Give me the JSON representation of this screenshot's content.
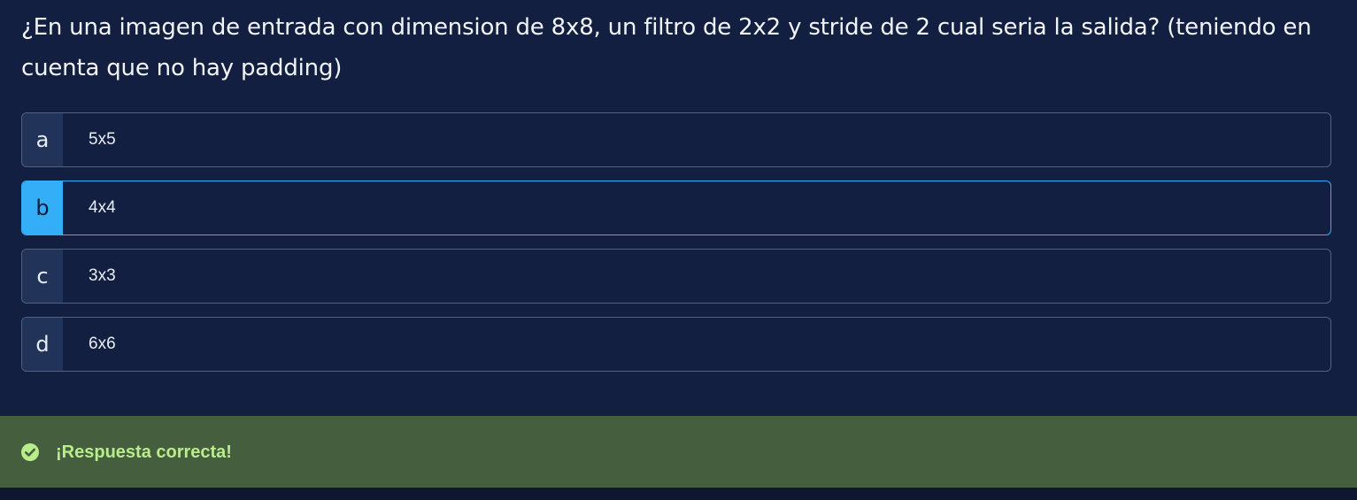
{
  "question": {
    "text": "¿En una imagen de entrada con dimension de 8x8, un filtro de 2x2 y stride de 2 cual seria la salida? (teniendo en cuenta que no hay padding)"
  },
  "options": [
    {
      "letter": "a",
      "text": "5x5",
      "selected": false
    },
    {
      "letter": "b",
      "text": "4x4",
      "selected": true
    },
    {
      "letter": "c",
      "text": "3x3",
      "selected": false
    },
    {
      "letter": "d",
      "text": "6x6",
      "selected": false
    }
  ],
  "feedback": {
    "icon": "check-circle-icon",
    "text": "¡Respuesta correcta!"
  },
  "colors": {
    "background": "#121f40",
    "selected_accent": "#34aef6",
    "feedback_background": "#445e3e",
    "feedback_text": "#b9ec8a"
  }
}
